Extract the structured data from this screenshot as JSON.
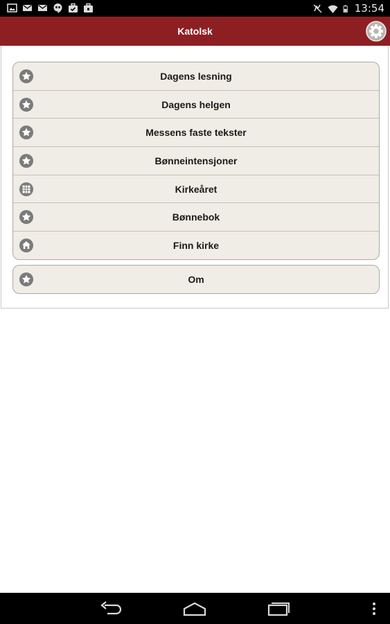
{
  "status_bar": {
    "time": "13:54",
    "icons": [
      "image-icon",
      "mail-icon",
      "mail-icon",
      "hangouts-icon",
      "briefcase-check-icon",
      "briefcase-lock-icon",
      "mute-icon",
      "wifi-icon",
      "battery-icon"
    ]
  },
  "app": {
    "title": "Katolsk",
    "settings_icon": "gear-icon",
    "accent_color": "#8d1f22"
  },
  "menu": {
    "items": [
      {
        "label": "Dagens lesning",
        "icon": "star-icon"
      },
      {
        "label": "Dagens helgen",
        "icon": "star-icon"
      },
      {
        "label": "Messens faste tekster",
        "icon": "star-icon"
      },
      {
        "label": "Bønneintensjoner",
        "icon": "star-icon"
      },
      {
        "label": "Kirkeåret",
        "icon": "grid-icon"
      },
      {
        "label": "Bønnebok",
        "icon": "star-icon"
      },
      {
        "label": "Finn kirke",
        "icon": "home-icon"
      }
    ],
    "about": {
      "label": "Om",
      "icon": "star-icon"
    }
  },
  "nav_bar": {
    "buttons": [
      "back-icon",
      "home-icon",
      "recent-apps-icon",
      "overflow-menu-icon"
    ]
  }
}
